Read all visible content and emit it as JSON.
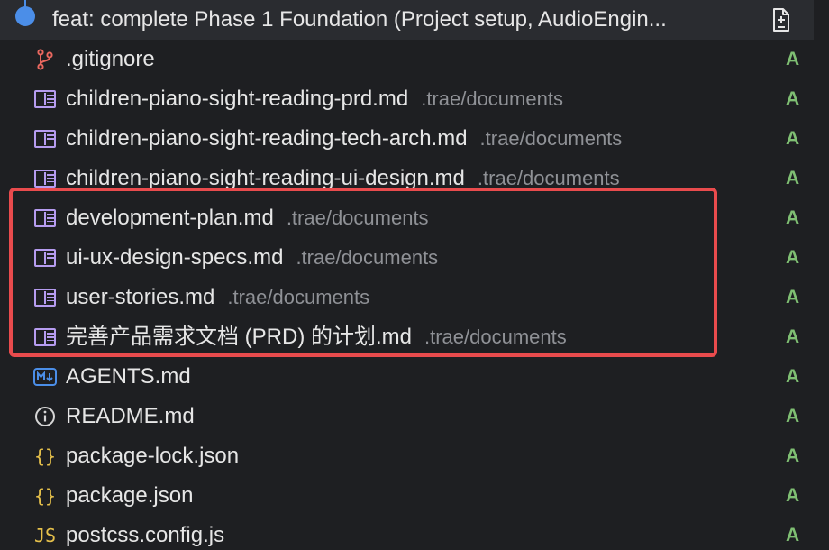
{
  "commit": {
    "title": "feat: complete Phase 1 Foundation (Project setup, AudioEngin..."
  },
  "files": [
    {
      "name": ".gitignore",
      "path": "",
      "status": "A",
      "icon": "git-branch-icon"
    },
    {
      "name": "children-piano-sight-reading-prd.md",
      "path": ".trae/documents",
      "status": "A",
      "icon": "markdown-doc-icon"
    },
    {
      "name": "children-piano-sight-reading-tech-arch.md",
      "path": ".trae/documents",
      "status": "A",
      "icon": "markdown-doc-icon"
    },
    {
      "name": "children-piano-sight-reading-ui-design.md",
      "path": ".trae/documents",
      "status": "A",
      "icon": "markdown-doc-icon"
    },
    {
      "name": "development-plan.md",
      "path": ".trae/documents",
      "status": "A",
      "icon": "markdown-doc-icon"
    },
    {
      "name": "ui-ux-design-specs.md",
      "path": ".trae/documents",
      "status": "A",
      "icon": "markdown-doc-icon"
    },
    {
      "name": "user-stories.md",
      "path": ".trae/documents",
      "status": "A",
      "icon": "markdown-doc-icon"
    },
    {
      "name": "完善产品需求文档 (PRD) 的计划.md",
      "path": ".trae/documents",
      "status": "A",
      "icon": "markdown-doc-icon"
    },
    {
      "name": "AGENTS.md",
      "path": "",
      "status": "A",
      "icon": "markdown-down-icon"
    },
    {
      "name": "README.md",
      "path": "",
      "status": "A",
      "icon": "info-icon"
    },
    {
      "name": "package-lock.json",
      "path": "",
      "status": "A",
      "icon": "json-braces-icon"
    },
    {
      "name": "package.json",
      "path": "",
      "status": "A",
      "icon": "json-braces-icon"
    },
    {
      "name": "postcss.config.js",
      "path": "",
      "status": "A",
      "icon": "javascript-icon"
    }
  ],
  "icon_glyphs": {
    "json": "{}",
    "js": "JS",
    "md_badge": "M↓",
    "info": "i"
  },
  "colors": {
    "background": "#1e1f22",
    "commit_header": "#2a2c30",
    "accent_blue": "#4b8ee8",
    "added_status": "#7fbf73",
    "markdown_icon": "#b69cf0",
    "highlight_red": "#e94b4d",
    "secondary_text": "#8f9196"
  }
}
